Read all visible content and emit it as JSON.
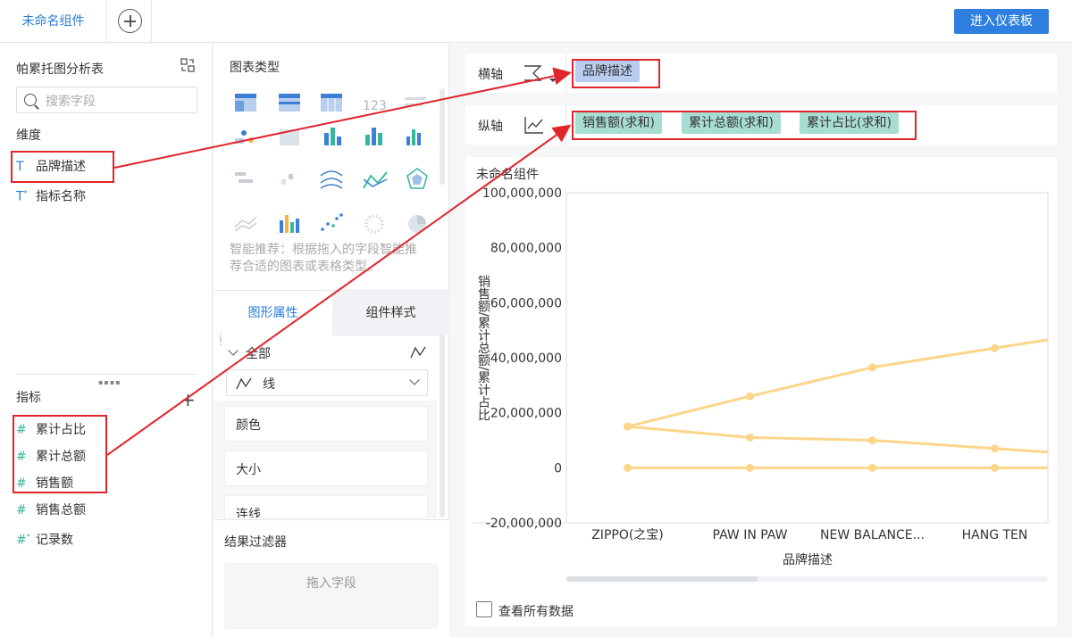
{
  "topbar": {
    "tab_label": "未命名组件",
    "enter_button": "进入仪表板"
  },
  "left": {
    "dataset_title": "帕累托图分析表",
    "search_placeholder": "搜索字段",
    "dimension_label": "维度",
    "dimensions": [
      {
        "label": "品牌描述",
        "type": "T"
      },
      {
        "label": "指标名称",
        "type": "T*"
      }
    ],
    "measure_label": "指标",
    "measures": [
      {
        "label": "累计占比",
        "type": "#"
      },
      {
        "label": "累计总额",
        "type": "#"
      },
      {
        "label": "销售额",
        "type": "#"
      },
      {
        "label": "销售总额",
        "type": "#"
      },
      {
        "label": "记录数",
        "type": "#*"
      }
    ]
  },
  "middle": {
    "chart_type_title": "图表类型",
    "hint": "智能推荐：根据拖入的字段智能推荐合适的图表或表格类型。",
    "tab_shape": "图形属性",
    "tab_style": "组件样式",
    "all_label": "全部",
    "line_type": "线",
    "props": [
      "颜色",
      "大小",
      "连线"
    ],
    "filter_title": "结果过滤器",
    "filter_drop": "拖入字段"
  },
  "axes": {
    "x_label": "横轴",
    "x_fields": [
      "品牌描述"
    ],
    "y_label": "纵轴",
    "y_fields": [
      "销售额(求和)",
      "累计总额(求和)",
      "累计占比(求和)"
    ]
  },
  "chart": {
    "title": "未命名组件",
    "view_all": "查看所有数据",
    "line_color": "#fcd58a"
  },
  "chart_data": {
    "type": "line",
    "categories": [
      "ZIPPO(之宝)",
      "PAW IN PAW",
      "NEW BALANCE...",
      "HANG TEN"
    ],
    "series": [
      {
        "values": [
          15000000,
          26000000,
          36500000,
          43500000
        ]
      },
      {
        "values": [
          15000000,
          11000000,
          10000000,
          7000000
        ]
      },
      {
        "values": [
          0,
          0,
          0,
          0
        ]
      }
    ],
    "xlabel": "品牌描述",
    "ylabel": "销售额/累计总额/累计占比",
    "ylim": [
      -20000000,
      100000000
    ],
    "yticks": [
      "100,000,000",
      "80,000,000",
      "60,000,000",
      "40,000,000",
      "20,000,000",
      "0",
      "-20,000,000"
    ]
  }
}
